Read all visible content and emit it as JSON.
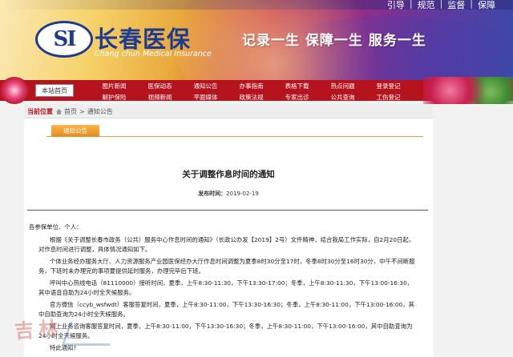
{
  "header": {
    "top_links": [
      "引导",
      "规范",
      "监督",
      "保障"
    ],
    "logo_text": "SI",
    "brand_cn": "长春医保",
    "brand_en": "Chang chun Medical Insurance",
    "slogan": "记录一生 保障一生 服务一生"
  },
  "nav": {
    "home_label": "本站首页",
    "items": [
      "图片新闻",
      "医保动态",
      "通知公告",
      "办事指南",
      "表格下载",
      "热点问题",
      "登录登记",
      "解护保险",
      "视频新闻",
      "平面媒体",
      "政策法规",
      "专家出诊",
      "公共查询",
      "工伤登记"
    ]
  },
  "breadcrumb": {
    "label": "当前位置",
    "items": [
      "首页",
      "通知公告"
    ],
    "separator": ">"
  },
  "tab_label": "通知公告",
  "article": {
    "title": "关于调整作息时间的通知",
    "date_label": "发布时间：",
    "date": "2019-02-19",
    "greeting": "各参保单位、个人：",
    "paragraphs": [
      "根据《关于调整长春市政务（公共）服务中心作息时间的通知》（长政公办发【2019】2号）文件精神，结合我局工作实际，自2月20日起，对作息时间进行调整，具体情况通知如下。",
      "个体业务经办服务大厅、人力资源服务产业园医保经办大厅作息时间调整为夏季8时30分至17时，冬季8时30分至16时30分，中午不间断服务，下班时未办理完的事项要提供延时服务，办理完毕后下班。",
      "呼叫中心热线电话（81110000）接听时间，夏季，上午8:30-11:30，下午13:30-17:00；冬季，上午8:30-11:30，下午13:00-16:30，其中语音自助为24小时全天候服务。",
      "官方微信（ccyb_wsfwdt）客服答复时间，夏季，上午8:30-11:00，下午13:30-16:30；冬季，上午8:30-11:00，下午13:00-16:00，其中自助查询为24小时全天候服务。",
      "网上业务咨询客服答复时间，夏季，上午8:30-11:00，下午13:30-16:30；冬季，上午8:30-11:00，下午13:00-16:00，其中自助查询为24小时全天候服务。",
      "特此通知！"
    ]
  },
  "watermark": "吉林"
}
